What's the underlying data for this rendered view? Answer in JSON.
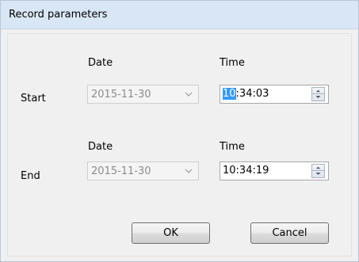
{
  "window": {
    "title": "Record parameters"
  },
  "start": {
    "row_label": "Start",
    "date_header": "Date",
    "time_header": "Time",
    "date_value": "2015-11-30",
    "time_selected": "10",
    "time_rest": ":34:03"
  },
  "end": {
    "row_label": "End",
    "date_header": "Date",
    "time_header": "Time",
    "date_value": "2015-11-30",
    "time_value": "10:34:19"
  },
  "buttons": {
    "ok": "OK",
    "cancel": "Cancel"
  },
  "icons": {
    "dropdown": "chevron-down-icon",
    "spin_up": "spin-up-icon",
    "spin_down": "spin-down-icon"
  },
  "colors": {
    "selection": "#3399ff",
    "titlebar": "#d9e6f5",
    "disabled_text": "#8c8c8c"
  }
}
